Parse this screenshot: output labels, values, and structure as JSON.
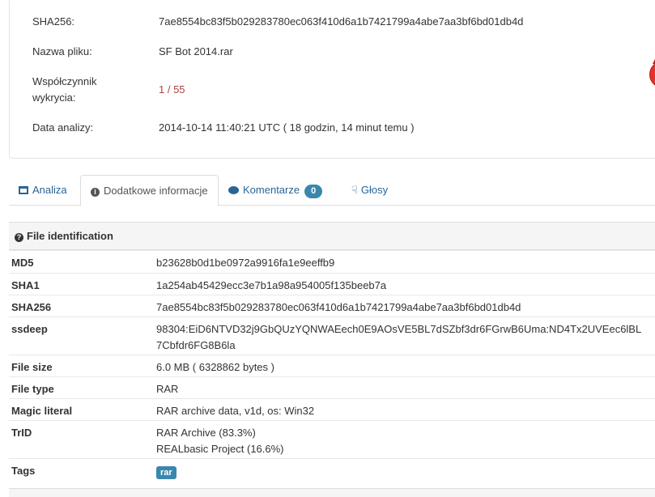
{
  "summary": {
    "sha256_label": "SHA256:",
    "sha256_value": "7ae8554bc83f5b029283780ec063f410d6a1b7421799a4abe7aa3bf6bd01db4d",
    "filename_label": "Nazwa pliku:",
    "filename_value": "SF Bot 2014.rar",
    "ratio_label_line1": "Współczynnik",
    "ratio_label_line2": "wykrycia:",
    "ratio_value": "1 / 55",
    "date_label": "Data analizy:",
    "date_value": "2014-10-14 11:40:21 UTC ( 18 godzin, 14 minut temu )",
    "ratio_color": "#a94442"
  },
  "tabs": [
    {
      "label": "Analiza",
      "icon": "table-icon"
    },
    {
      "label": "Dodatkowe informacje",
      "icon": "info-icon"
    },
    {
      "label": "Komentarze",
      "icon": "comment-icon",
      "badge": "0"
    },
    {
      "label": "Głosy",
      "icon": "thumbs-icon"
    }
  ],
  "file_identification": {
    "title": "File identification",
    "rows": [
      {
        "key": "MD5",
        "value": "b23628b0d1be0972a9916fa1e9eeffb9"
      },
      {
        "key": "SHA1",
        "value": "1a254ab45429ecc3e7b1a98a954005f135beeb7a"
      },
      {
        "key": "SHA256",
        "value": "7ae8554bc83f5b029283780ec063f410d6a1b7421799a4abe7aa3bf6bd01db4d"
      },
      {
        "key": "ssdeep",
        "value_line1": "98304:EiD6NTVD32j9GbQUzYQNWAEech0E9AOsVE5BL7dSZbf3dr6FGrwB6Uma:ND4Tx2UVEec6lBL",
        "value_line2": "7Cbfdr6FG8B6la"
      },
      {
        "key": "File size",
        "value": "6.0 MB ( 6328862 bytes )"
      },
      {
        "key": "File type",
        "value": "RAR"
      },
      {
        "key": "Magic literal",
        "value": "RAR archive data, v1d, os: Win32"
      },
      {
        "key": "TrID",
        "value_line1": "RAR Archive (83.3%)",
        "value_line2": "REALbasic Project (16.6%)"
      },
      {
        "key": "Tags",
        "tag": "rar"
      }
    ]
  },
  "colors": {
    "link": "#2a6496",
    "badge": "#3a87ad",
    "devil": "#e2332f"
  }
}
